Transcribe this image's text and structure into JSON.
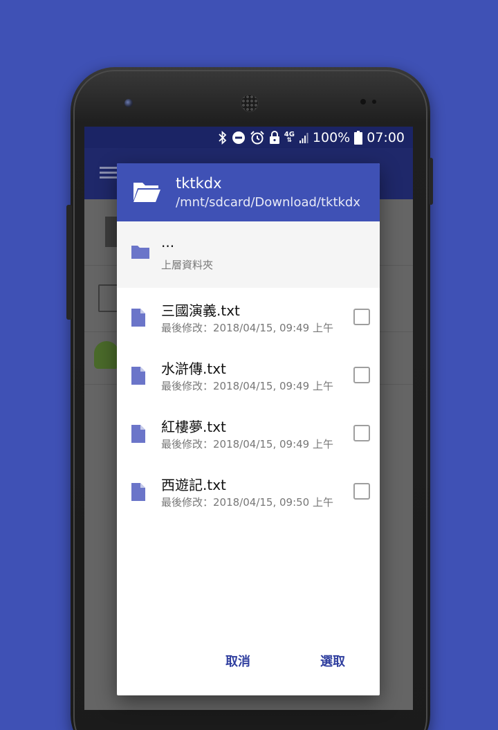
{
  "status_bar": {
    "battery": "100%",
    "time": "07:00",
    "network": "4G",
    "icons": [
      "bluetooth-icon",
      "do-not-disturb-icon",
      "alarm-icon",
      "lock-icon",
      "signal-icon",
      "battery-icon"
    ]
  },
  "dialog": {
    "title": "tktkdx",
    "path": "/mnt/sdcard/Download/tktkdx",
    "parent": {
      "label": "...",
      "sublabel": "上層資料夾"
    },
    "files": [
      {
        "name": "三國演義.txt",
        "modified": "最後修改：2018/04/15, 09:49 上午",
        "checked": false
      },
      {
        "name": "水滸傳.txt",
        "modified": "最後修改：2018/04/15, 09:49 上午",
        "checked": false
      },
      {
        "name": "紅樓夢.txt",
        "modified": "最後修改：2018/04/15, 09:49 上午",
        "checked": false
      },
      {
        "name": "西遊記.txt",
        "modified": "最後修改：2018/04/15, 09:50 上午",
        "checked": false
      }
    ],
    "cancel_label": "取消",
    "select_label": "選取"
  },
  "colors": {
    "background": "#3f51b5",
    "header": "#3f51b5",
    "accent": "#303f9f",
    "file_icon": "#6b75c9"
  }
}
